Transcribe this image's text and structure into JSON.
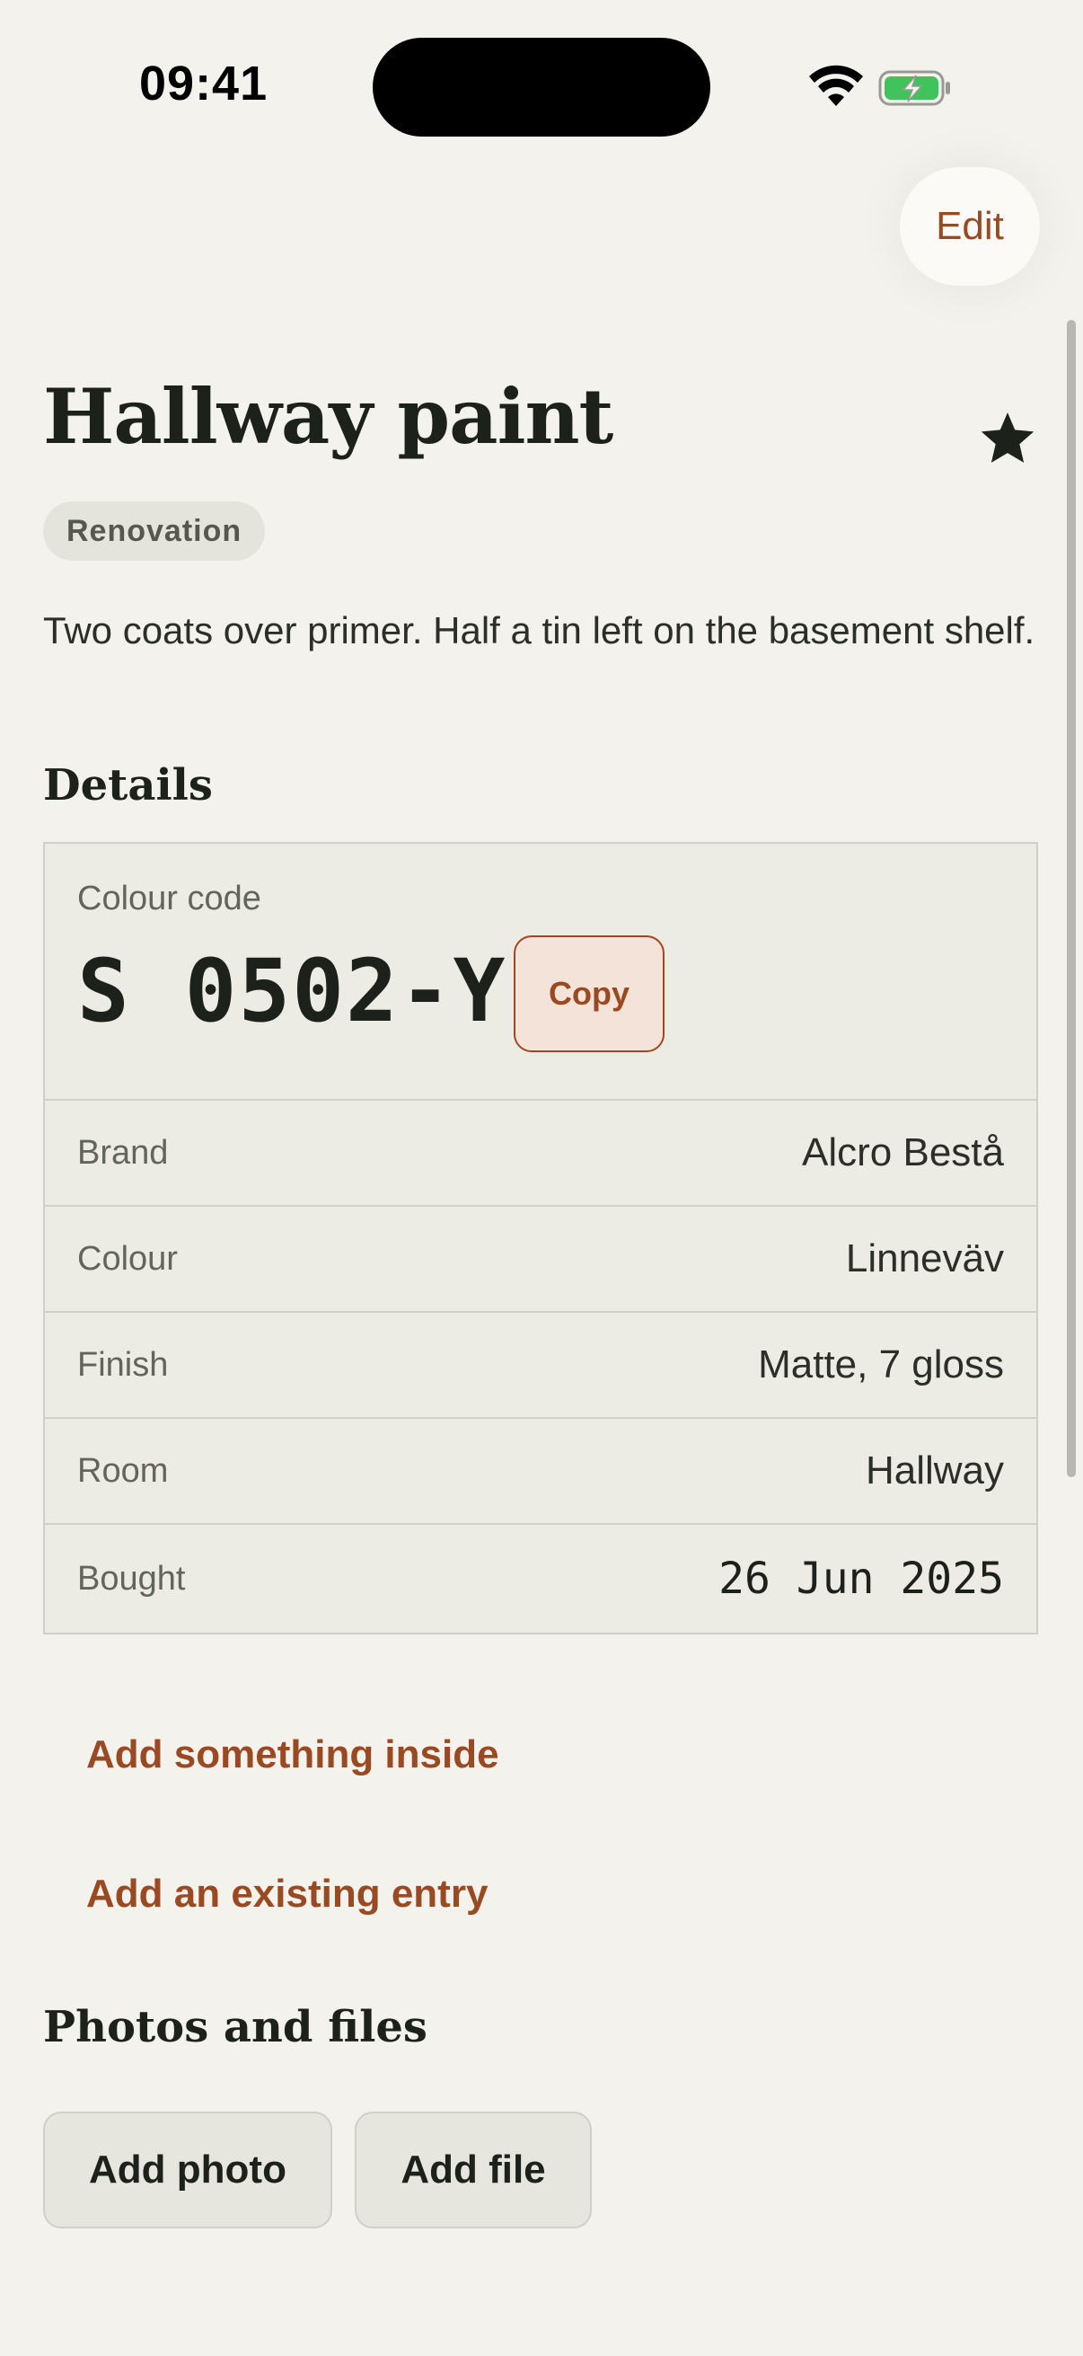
{
  "status_bar": {
    "time": "09:41"
  },
  "header": {
    "edit_label": "Edit"
  },
  "item": {
    "title": "Hallway paint",
    "favourite": true,
    "tag": "Renovation",
    "description": "Two coats over primer. Half a tin left on the basement shelf."
  },
  "details": {
    "heading": "Details",
    "colour_code_label": "Colour code",
    "colour_code": "S 0502-Y",
    "copy_label": "Copy",
    "rows": [
      {
        "label": "Brand",
        "value": "Alcro Bestå"
      },
      {
        "label": "Colour",
        "value": "Linneväv"
      },
      {
        "label": "Finish",
        "value": "Matte, 7 gloss"
      },
      {
        "label": "Room",
        "value": "Hallway"
      },
      {
        "label": "Bought",
        "value": "26 Jun 2025"
      }
    ]
  },
  "actions": {
    "add_inside": "Add something inside",
    "add_existing": "Add an existing entry"
  },
  "attachments": {
    "heading": "Photos and files",
    "add_photo": "Add photo",
    "add_file": "Add file"
  },
  "icons": {
    "wifi": "wifi-icon",
    "battery": "battery-charging-icon",
    "star": "star-filled-icon"
  },
  "colors": {
    "background": "#f3f2ec",
    "accent": "#9a4a22",
    "card": "#edece4",
    "text": "#1d211c",
    "battery": "#3fc35a"
  }
}
